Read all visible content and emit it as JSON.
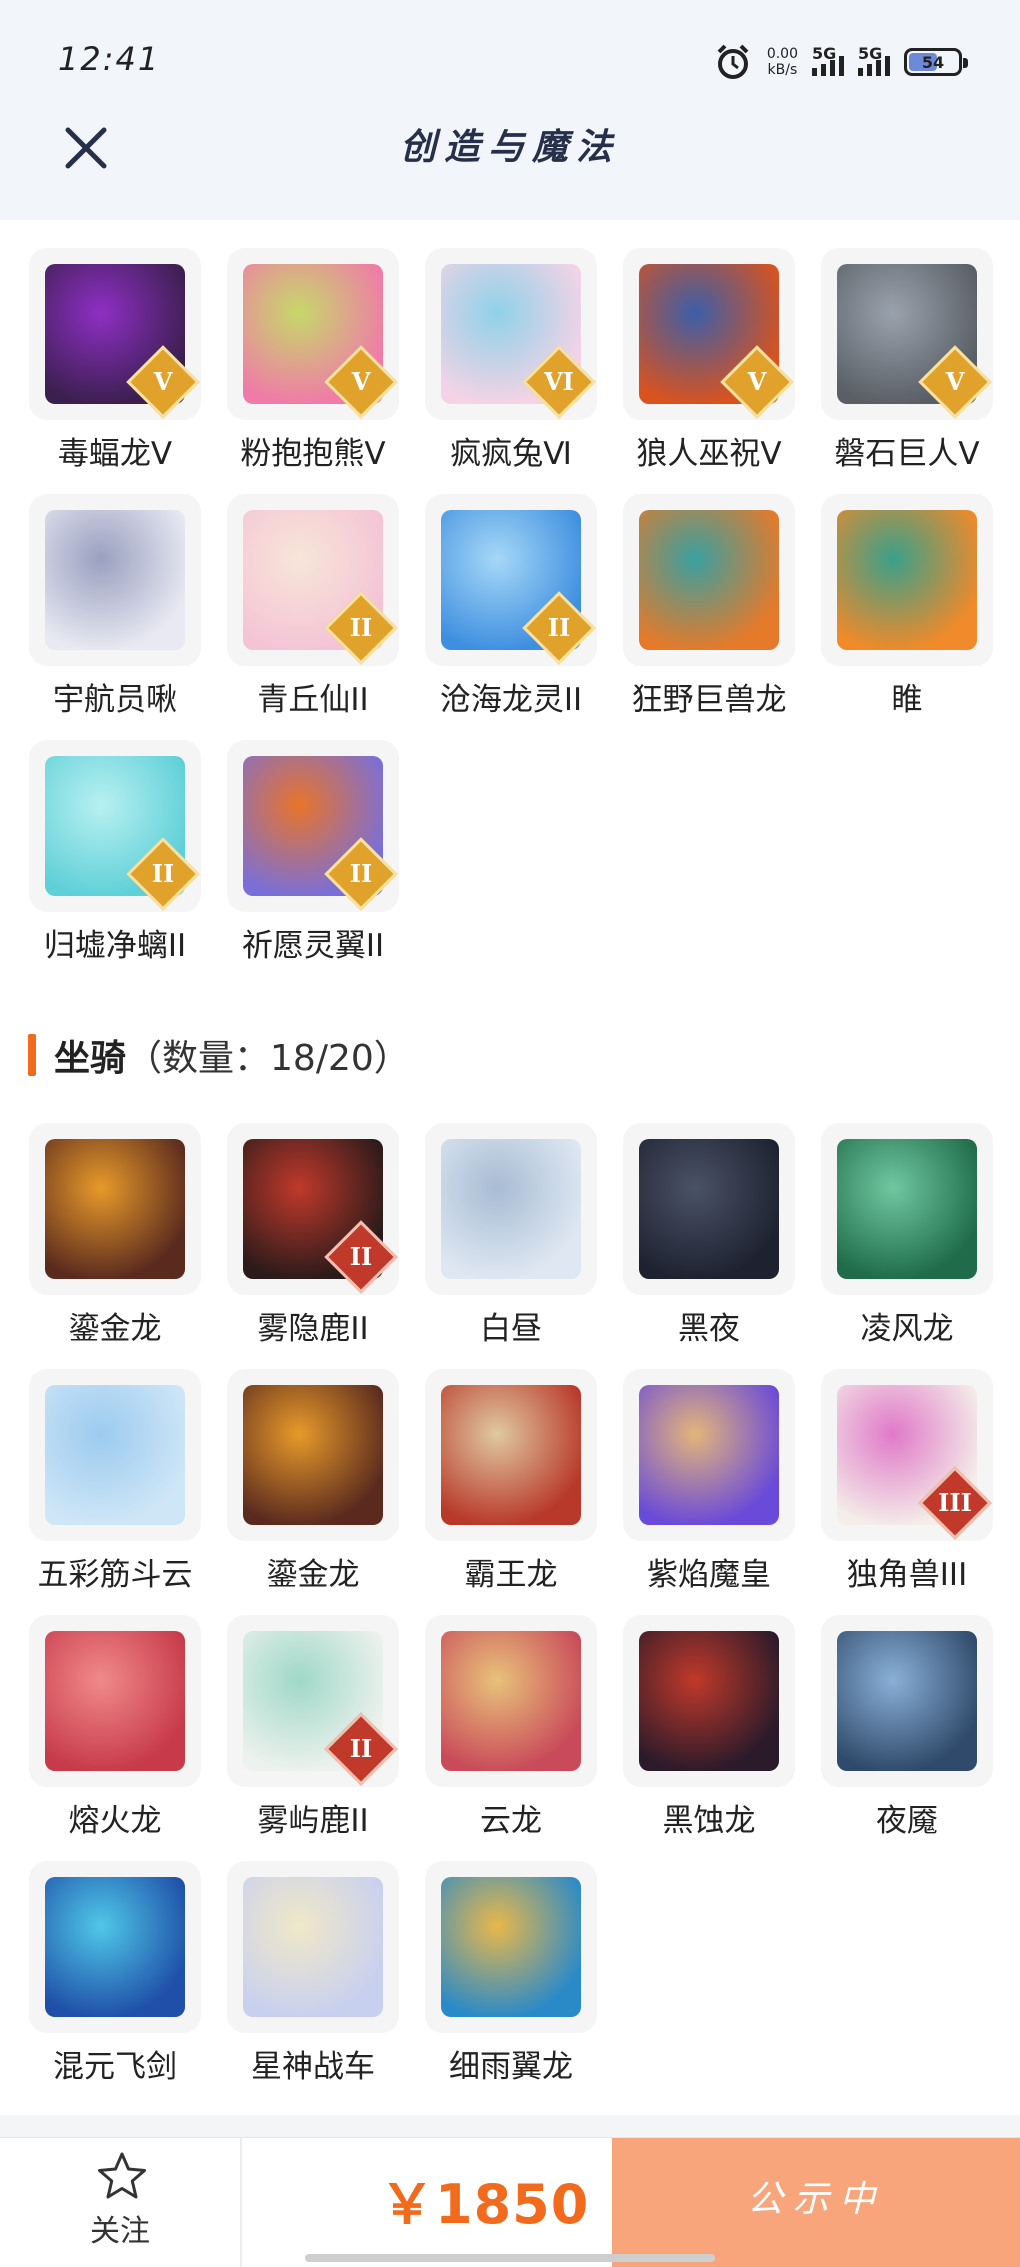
{
  "status_bar": {
    "time": "12:41",
    "speed_value": "0.00",
    "speed_unit": "kB/s",
    "sig1": "5G",
    "sig2": "5G",
    "battery": "54"
  },
  "header": {
    "title": "创造与魔法"
  },
  "pets": [
    {
      "label": "毒蝠龙Ⅴ",
      "badge": "V",
      "badge_color": "gold",
      "colors": [
        "#3b1f4f",
        "#8e2fc4"
      ]
    },
    {
      "label": "粉抱抱熊Ⅴ",
      "badge": "V",
      "badge_color": "gold",
      "colors": [
        "#f07aa8",
        "#c6d86a"
      ]
    },
    {
      "label": "疯疯兔Ⅵ",
      "badge": "VI",
      "badge_color": "gold",
      "colors": [
        "#f5d3e6",
        "#8fd2e8"
      ]
    },
    {
      "label": "狼人巫祝Ⅴ",
      "badge": "V",
      "badge_color": "gold",
      "colors": [
        "#d9531e",
        "#3c5fa8"
      ]
    },
    {
      "label": "磐石巨人Ⅴ",
      "badge": "V",
      "badge_color": "gold",
      "colors": [
        "#5a5f66",
        "#9aa2ad"
      ]
    },
    {
      "label": "宇航员啾",
      "badge": "",
      "badge_color": "",
      "colors": [
        "#e8e9f2",
        "#9aa0c0"
      ]
    },
    {
      "label": "青丘仙II",
      "badge": "II",
      "badge_color": "gold",
      "colors": [
        "#f4c4d6",
        "#f7e6d8"
      ]
    },
    {
      "label": "沧海龙灵II",
      "badge": "II",
      "badge_color": "gold",
      "colors": [
        "#3f8fe0",
        "#a6d8f7"
      ]
    },
    {
      "label": "狂野巨兽龙",
      "badge": "",
      "badge_color": "",
      "colors": [
        "#e57a2a",
        "#3aa0a0"
      ]
    },
    {
      "label": "睢",
      "badge": "",
      "badge_color": "",
      "colors": [
        "#f08a2a",
        "#3aa08a"
      ]
    },
    {
      "label": "归墟净螭II",
      "badge": "II",
      "badge_color": "gold",
      "colors": [
        "#5fd0d8",
        "#b8f0f0"
      ]
    },
    {
      "label": "祈愿灵翼II",
      "badge": "II",
      "badge_color": "gold",
      "colors": [
        "#7a6fd8",
        "#e8742a"
      ]
    }
  ],
  "mounts_section": {
    "title": "坐骑",
    "count": "（数量：18/20）"
  },
  "mounts": [
    {
      "label": "鎏金龙",
      "badge": "",
      "badge_color": "",
      "colors": [
        "#5a2a1e",
        "#e79a2a"
      ]
    },
    {
      "label": "雾隐鹿II",
      "badge": "II",
      "badge_color": "red",
      "colors": [
        "#2a1a1a",
        "#c0392b"
      ]
    },
    {
      "label": "白昼",
      "badge": "",
      "badge_color": "",
      "colors": [
        "#dfe8f2",
        "#a8bcd4"
      ]
    },
    {
      "label": "黑夜",
      "badge": "",
      "badge_color": "",
      "colors": [
        "#1e2230",
        "#4a5266"
      ]
    },
    {
      "label": "凌风龙",
      "badge": "",
      "badge_color": "",
      "colors": [
        "#1f6b4a",
        "#6fc8a0"
      ]
    },
    {
      "label": "五彩筋斗云",
      "badge": "",
      "badge_color": "",
      "colors": [
        "#cfe6f7",
        "#9ccbef"
      ]
    },
    {
      "label": "鎏金龙",
      "badge": "",
      "badge_color": "",
      "colors": [
        "#5a2a1e",
        "#e79a2a"
      ]
    },
    {
      "label": "霸王龙",
      "badge": "",
      "badge_color": "",
      "colors": [
        "#b8382a",
        "#e0c9a0"
      ]
    },
    {
      "label": "紫焰魔皇",
      "badge": "",
      "badge_color": "",
      "colors": [
        "#6a4ad8",
        "#e3b57a"
      ]
    },
    {
      "label": "独角兽III",
      "badge": "III",
      "badge_color": "red",
      "colors": [
        "#f4ede8",
        "#e079c8"
      ]
    },
    {
      "label": "熔火龙",
      "badge": "",
      "badge_color": "",
      "colors": [
        "#c73a4a",
        "#f08a8a"
      ]
    },
    {
      "label": "雾屿鹿II",
      "badge": "II",
      "badge_color": "red",
      "colors": [
        "#eef2ee",
        "#9fd8c8"
      ]
    },
    {
      "label": "云龙",
      "badge": "",
      "badge_color": "",
      "colors": [
        "#c94a5a",
        "#e8c27a"
      ]
    },
    {
      "label": "黑蚀龙",
      "badge": "",
      "badge_color": "",
      "colors": [
        "#2a1a2a",
        "#c0392b"
      ]
    },
    {
      "label": "夜魇",
      "badge": "",
      "badge_color": "",
      "colors": [
        "#2f4a6a",
        "#8ab0d8"
      ]
    },
    {
      "label": "混元飞剑",
      "badge": "",
      "badge_color": "",
      "colors": [
        "#1f4fa8",
        "#4fc8e8"
      ]
    },
    {
      "label": "星神战车",
      "badge": "",
      "badge_color": "",
      "colors": [
        "#c8d0f0",
        "#f0e8c8"
      ]
    },
    {
      "label": "细雨翼龙",
      "badge": "",
      "badge_color": "",
      "colors": [
        "#2a8ac8",
        "#e8b84a"
      ]
    }
  ],
  "bottom": {
    "follow_label": "关注",
    "price": "￥1850",
    "status_button": "公示中"
  }
}
